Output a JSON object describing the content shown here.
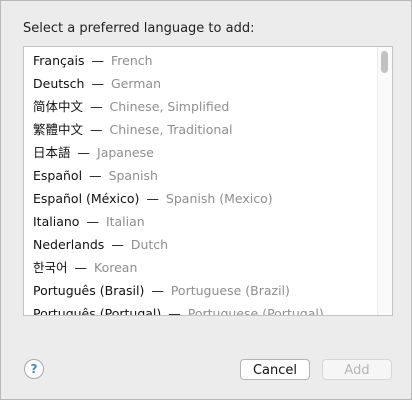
{
  "dialog": {
    "title": "Select a preferred language to add:"
  },
  "languages": [
    {
      "native": "Français",
      "english": "French"
    },
    {
      "native": "Deutsch",
      "english": "German"
    },
    {
      "native": "简体中文",
      "english": "Chinese, Simplified"
    },
    {
      "native": "繁體中文",
      "english": "Chinese, Traditional"
    },
    {
      "native": "日本語",
      "english": "Japanese"
    },
    {
      "native": "Español",
      "english": "Spanish"
    },
    {
      "native": "Español (México)",
      "english": "Spanish (Mexico)"
    },
    {
      "native": "Italiano",
      "english": "Italian"
    },
    {
      "native": "Nederlands",
      "english": "Dutch"
    },
    {
      "native": "한국어",
      "english": "Korean"
    },
    {
      "native": "Português (Brasil)",
      "english": "Portuguese (Brazil)"
    },
    {
      "native": "Português (Portugal)",
      "english": "Portuguese (Portugal)"
    }
  ],
  "separator": "—",
  "buttons": {
    "help_label": "?",
    "cancel_label": "Cancel",
    "add_label": "Add"
  },
  "colors": {
    "accent": "#3a8ad8",
    "secondary_text": "#8e8e8e"
  }
}
